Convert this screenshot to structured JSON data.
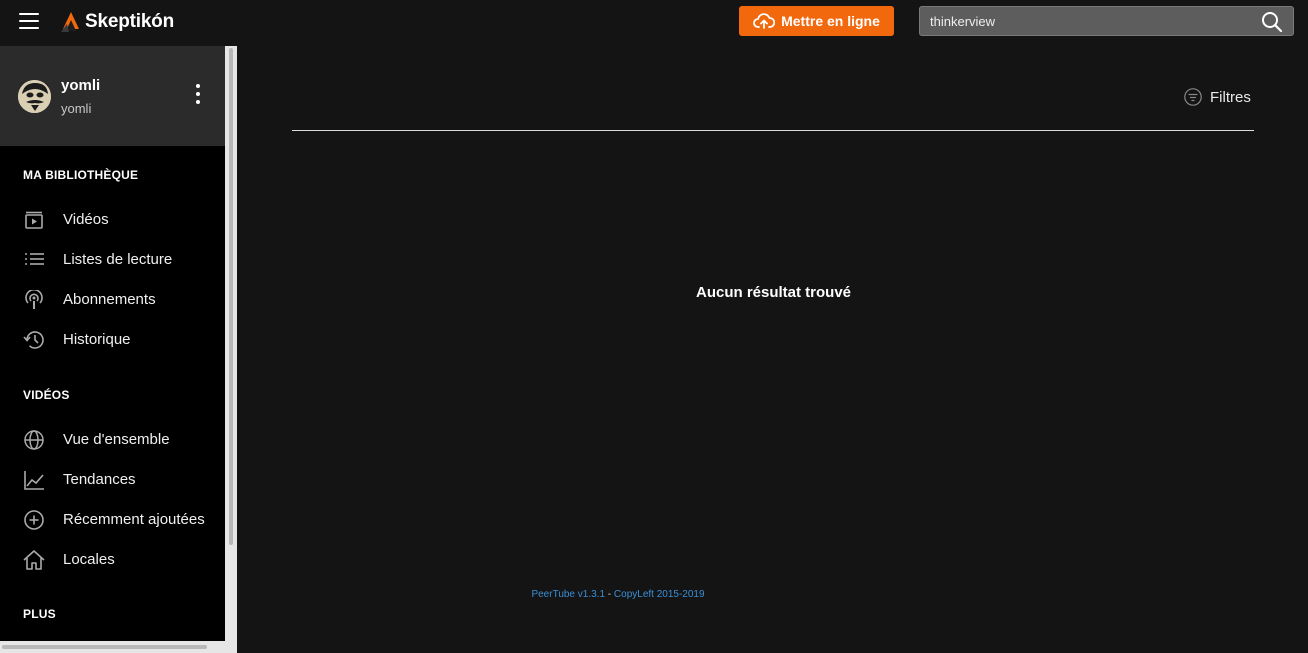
{
  "header": {
    "brand": "Skeptikón",
    "upload_label": "Mettre en ligne",
    "search_value": "thinkerview",
    "search_placeholder": "",
    "accent_color": "#f1680d"
  },
  "user": {
    "name": "yomli",
    "handle": "yomli"
  },
  "sidebar": {
    "library_title": "MA BIBLIOTHÈQUE",
    "library_items": [
      {
        "label": "Vidéos",
        "icon": "video-icon"
      },
      {
        "label": "Listes de lecture",
        "icon": "playlist-icon"
      },
      {
        "label": "Abonnements",
        "icon": "subscriptions-icon"
      },
      {
        "label": "Historique",
        "icon": "history-icon"
      }
    ],
    "videos_title": "VIDÉOS",
    "videos_items": [
      {
        "label": "Vue d'ensemble",
        "icon": "globe-icon"
      },
      {
        "label": "Tendances",
        "icon": "trending-icon"
      },
      {
        "label": "Récemment ajoutées",
        "icon": "add-circle-icon"
      },
      {
        "label": "Locales",
        "icon": "home-icon"
      }
    ],
    "more_title": "PLUS"
  },
  "main": {
    "filters_label": "Filtres",
    "no_results": "Aucun résultat trouvé"
  },
  "footer": {
    "version": "PeerTube v1.3.1",
    "separator": " - ",
    "copyleft": "CopyLeft 2015-2019"
  }
}
